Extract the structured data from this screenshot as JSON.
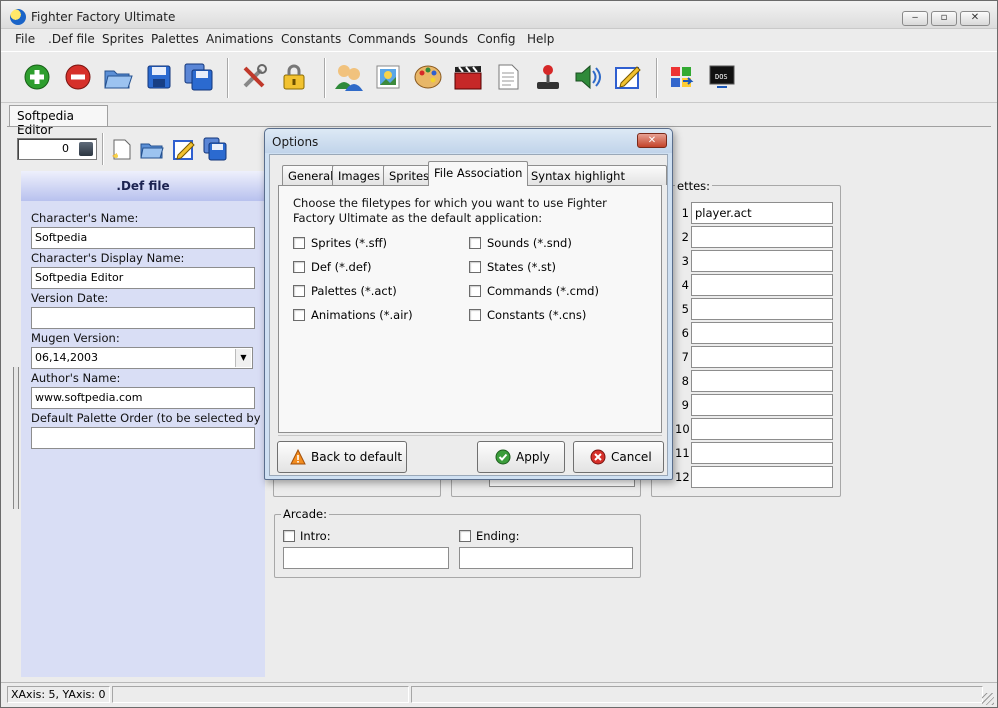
{
  "window": {
    "title": "Fighter Factory Ultimate",
    "minimize": "‒",
    "maximize": "▫",
    "close": "✕"
  },
  "menu": [
    "File",
    ".Def file",
    "Sprites",
    "Palettes",
    "Animations",
    "Constants",
    "Commands",
    "Sounds",
    "Config",
    "Help"
  ],
  "toolbar_icons": [
    "new-icon",
    "close-project-icon",
    "open-icon",
    "save-icon",
    "save-all-icon",
    "tools-icon",
    "lock-icon",
    "character-icon",
    "image-icon",
    "palette-icon",
    "animation-icon",
    "document-icon",
    "joystick-icon",
    "sound-icon",
    "edit-icon",
    "windows-icon",
    "dos-icon"
  ],
  "editor_tab": "Softpedia Editor",
  "number_box": {
    "value": "0"
  },
  "def_panel": {
    "header": ".Def file",
    "fields": [
      {
        "label": "Character's Name:",
        "value": "Softpedia"
      },
      {
        "label": "Character's Display Name:",
        "value": "Softpedia Editor"
      },
      {
        "label": "Version Date:",
        "value": ""
      },
      {
        "label": "Mugen Version:",
        "value": "06,14,2003"
      },
      {
        "label": "Author's Name:",
        "value": "www.softpedia.com"
      },
      {
        "label": "Default Palette Order (to be selected by AI):",
        "value": ""
      }
    ]
  },
  "palettes": {
    "title": "ettes:",
    "rows": [
      {
        "num": "1",
        "value": "player.act"
      },
      {
        "num": "2",
        "value": ""
      },
      {
        "num": "3",
        "value": ""
      },
      {
        "num": "4",
        "value": ""
      },
      {
        "num": "5",
        "value": ""
      },
      {
        "num": "6",
        "value": ""
      },
      {
        "num": "7",
        "value": ""
      },
      {
        "num": "8",
        "value": ""
      },
      {
        "num": "9",
        "value": ""
      },
      {
        "num": "10",
        "value": ""
      },
      {
        "num": "11",
        "value": ""
      },
      {
        "num": "12",
        "value": ""
      }
    ]
  },
  "arcade": {
    "title": "Arcade:",
    "intro_label": "Intro:",
    "ending_label": "Ending:"
  },
  "dialog": {
    "title": "Options",
    "close": "✕",
    "tabs": [
      "General",
      "Images",
      "Sprites",
      "File Association",
      "Syntax highlight colors"
    ],
    "active_tab": "File Association",
    "description": "Choose the filetypes for which you want to use Fighter Factory Ultimate as the default application:",
    "left_options": [
      "Sprites (*.sff)",
      "Def (*.def)",
      "Palettes (*.act)",
      "Animations (*.air)"
    ],
    "right_options": [
      "Sounds (*.snd)",
      "States (*.st)",
      "Commands (*.cmd)",
      "Constants (*.cns)"
    ],
    "buttons": {
      "back_to_default": "Back to default",
      "apply": "Apply",
      "cancel": "Cancel"
    }
  },
  "statusbar": {
    "coords": "XAxis: 5, YAxis: 0"
  },
  "colors": {
    "panel_bg": "#d9def5",
    "dialog_frame": "#cfe0f2",
    "window_bg": "#ececec"
  }
}
